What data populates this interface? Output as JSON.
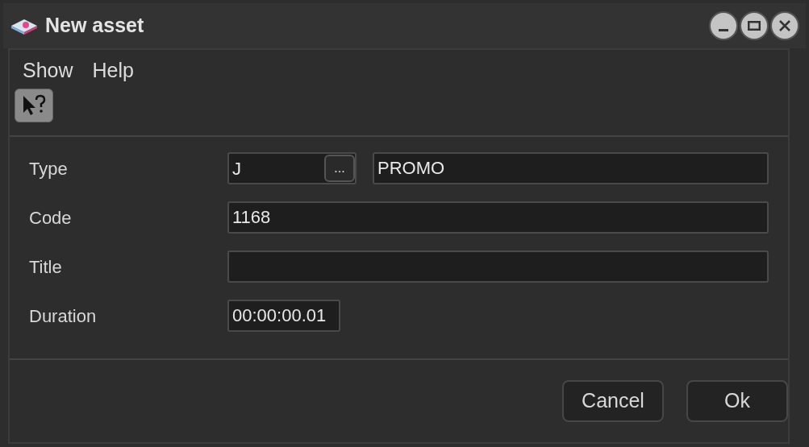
{
  "window": {
    "title": "New asset"
  },
  "menu": [
    "Show",
    "Help"
  ],
  "fields": [
    {
      "kind": "lookup",
      "label": "Type",
      "value": "J",
      "browse": "...",
      "description": "PROMO"
    },
    {
      "kind": "text",
      "label": "Code",
      "value": "1168"
    },
    {
      "kind": "text",
      "label": "Title"
    },
    {
      "kind": "short",
      "label": "Duration",
      "value": "00:00:00.01"
    }
  ],
  "buttons": [
    "Cancel",
    "Ok"
  ]
}
